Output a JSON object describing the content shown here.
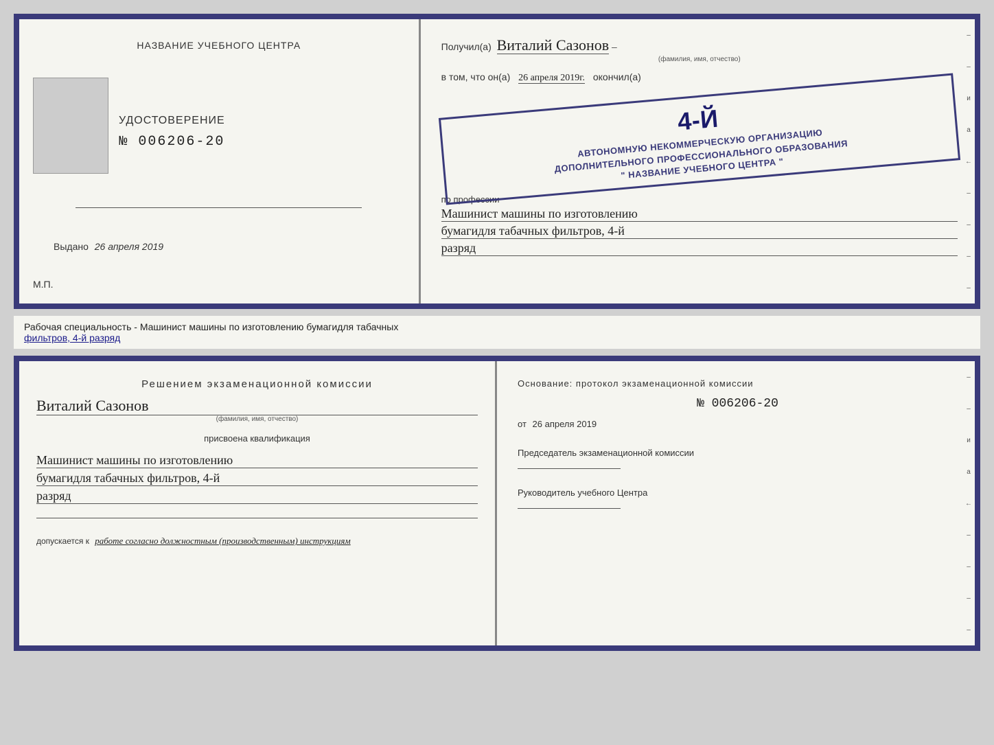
{
  "top_left": {
    "title": "НАЗВАНИЕ УЧЕБНОГО ЦЕНТРА",
    "udost_title": "УДОСТОВЕРЕНИЕ",
    "udost_number": "№ 006206-20",
    "vydano_label": "Выдано",
    "vydano_date": "26 апреля 2019",
    "mp_label": "М.П."
  },
  "top_right": {
    "poluchil_prefix": "Получил(а)",
    "poluchil_name": "Виталий Сазонов",
    "fio_label": "(фамилия, имя, отчество)",
    "vtom_prefix": "в том, что он(а)",
    "vtom_date": "26 апреля 2019г.",
    "okonchil_suffix": "окончил(а)",
    "stamp_number": "4-й",
    "stamp_line1": "АВТОНОМНУЮ НЕКОММЕРЧЕСКУЮ ОРГАНИЗАЦИЮ",
    "stamp_line2": "ДОПОЛНИТЕЛЬНОГО ПРОФЕССИОНАЛЬНОГО ОБРАЗОВАНИЯ",
    "stamp_line3": "\" НАЗВАНИЕ УЧЕБНОГО ЦЕНТРА \"",
    "profession_prefix": "по профессии",
    "profession_line1": "Машинист машины по изготовлению",
    "profession_line2": "бумагидля табачных фильтров, 4-й",
    "profession_line3": "разряд"
  },
  "middle": {
    "text": "Рабочая специальность - Машинист машины по изготовлению бумагидля табачных",
    "text2": "фильтров, 4-й разряд"
  },
  "bottom_left": {
    "resheniem_title": "Решением экзаменационной комиссии",
    "name_handwritten": "Виталий Сазонов",
    "fio_label": "(фамилия, имя, отчество)",
    "prisvoena": "присвоена квалификация",
    "qual_line1": "Машинист машины по изготовлению",
    "qual_line2": "бумагидля табачных фильтров, 4-й",
    "qual_line3": "разряд",
    "dopusk_prefix": "допускается к",
    "dopusk_text": "работе согласно должностным (производственным) инструкциям"
  },
  "bottom_right": {
    "osnovanie": "Основание: протокол экзаменационной комиссии",
    "number": "№ 006206-20",
    "ot_prefix": "от",
    "ot_date": "26 апреля 2019",
    "predsedatel_label": "Председатель экзаменационной комиссии",
    "rukovoditel_label": "Руководитель учебного Центра"
  },
  "side_dashes": [
    "–",
    "–",
    "и",
    "а",
    "←",
    "–",
    "–",
    "–",
    "–"
  ]
}
